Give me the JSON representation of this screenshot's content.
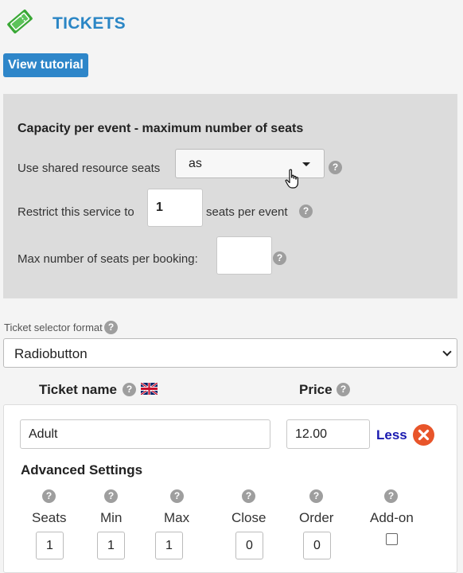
{
  "header": {
    "title": "TICKETS",
    "icon": "ticket-icon",
    "tutorial_label": "View tutorial",
    "accent_color": "#2b86c5"
  },
  "capacity": {
    "title": "Capacity per event - maximum number of seats",
    "shared_label": "Use shared resource seats",
    "shared_value": "as",
    "restrict_label": "Restrict this service to",
    "restrict_value": "1",
    "restrict_suffix": "seats per event",
    "max_label": "Max number of seats per booking:",
    "max_value": ""
  },
  "ticket_selector": {
    "label": "Ticket selector format",
    "value": "Radiobutton"
  },
  "ticket_table": {
    "name_header": "Ticket name",
    "price_header": "Price"
  },
  "ticket": {
    "name": "Adult",
    "price": "12.00",
    "less_label": "Less",
    "advanced_title": "Advanced Settings",
    "fields": [
      {
        "label": "Seats",
        "value": "1"
      },
      {
        "label": "Min",
        "value": "1"
      },
      {
        "label": "Max",
        "value": "1"
      },
      {
        "label": "Close",
        "value": "0"
      },
      {
        "label": "Order",
        "value": "0"
      },
      {
        "label": "Add-on",
        "checked": false
      }
    ]
  },
  "help_glyph": "?"
}
